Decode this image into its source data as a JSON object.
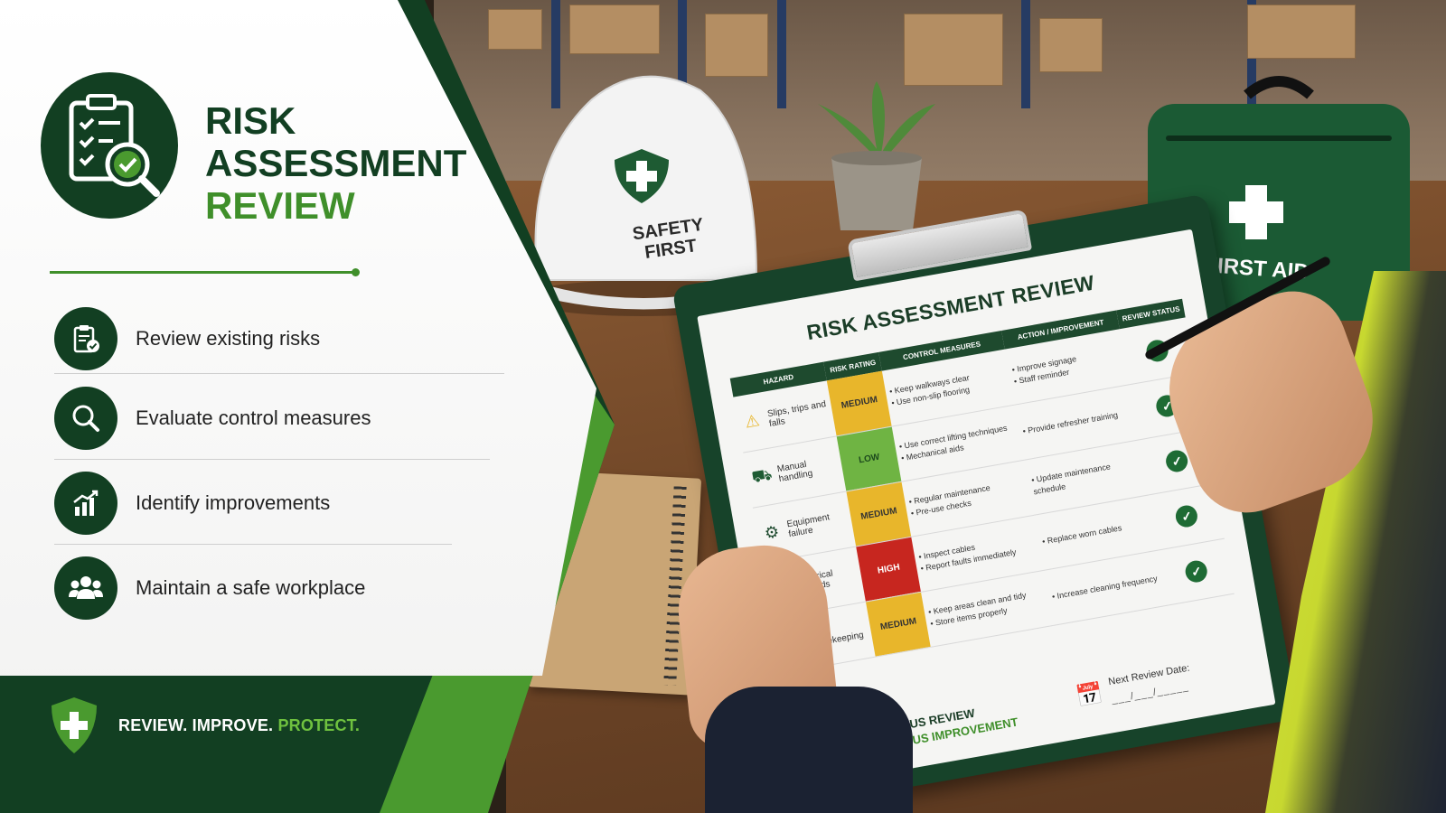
{
  "header": {
    "title_line1": "RISK",
    "title_line2": "ASSESSMENT",
    "title_line3": "REVIEW"
  },
  "checklist": [
    {
      "label": "Review existing risks",
      "icon": "clipboard-check-icon"
    },
    {
      "label": "Evaluate control measures",
      "icon": "magnifier-icon"
    },
    {
      "label": "Identify improvements",
      "icon": "bar-chart-up-icon"
    },
    {
      "label": "Maintain a safe workplace",
      "icon": "people-icon"
    }
  ],
  "tagline": {
    "part1": "REVIEW. IMPROVE.",
    "part2": "PROTECT."
  },
  "helmet": {
    "line1": "SAFETY",
    "line2": "FIRST"
  },
  "first_aid": {
    "label": "FIRST AID"
  },
  "clipboard": {
    "title": "RISK ASSESSMENT REVIEW",
    "columns": {
      "hazard": "HAZARD",
      "risk_rating": "RISK RATING",
      "control_measures": "CONTROL MEASURES",
      "action": "ACTION / IMPROVEMENT",
      "status": "REVIEW STATUS"
    },
    "rows": [
      {
        "hazard": "Slips, trips and falls",
        "rating": "MEDIUM",
        "controls": [
          "Keep walkways clear",
          "Use non-slip flooring"
        ],
        "actions": [
          "Improve signage",
          "Staff reminder"
        ],
        "status": "✓"
      },
      {
        "hazard": "Manual handling",
        "rating": "LOW",
        "controls": [
          "Use correct lifting techniques",
          "Mechanical aids"
        ],
        "actions": [
          "Provide refresher training"
        ],
        "status": "✓"
      },
      {
        "hazard": "Equipment failure",
        "rating": "MEDIUM",
        "controls": [
          "Regular maintenance",
          "Pre-use checks"
        ],
        "actions": [
          "Update maintenance schedule"
        ],
        "status": "✓"
      },
      {
        "hazard": "Electrical hazards",
        "rating": "HIGH",
        "controls": [
          "Inspect cables",
          "Report faults immediately"
        ],
        "actions": [
          "Replace worn cables"
        ],
        "status": "✓"
      },
      {
        "hazard": "Poor housekeeping",
        "rating": "MEDIUM",
        "controls": [
          "Keep areas clean and tidy",
          "Store items properly"
        ],
        "actions": [
          "Increase cleaning frequency"
        ],
        "status": "✓"
      }
    ],
    "footer": {
      "line1": "CONTINUOUS REVIEW",
      "line2": "CONTINUOUS IMPROVEMENT",
      "next_review_label": "Next Review Date:",
      "next_review_value": "___/___/_____"
    }
  },
  "colors": {
    "brand_dark": "#123f22",
    "brand_accent": "#3f8f2a",
    "rating_medium": "#e8b62b",
    "rating_low": "#6fb443",
    "rating_high": "#c7261f"
  }
}
